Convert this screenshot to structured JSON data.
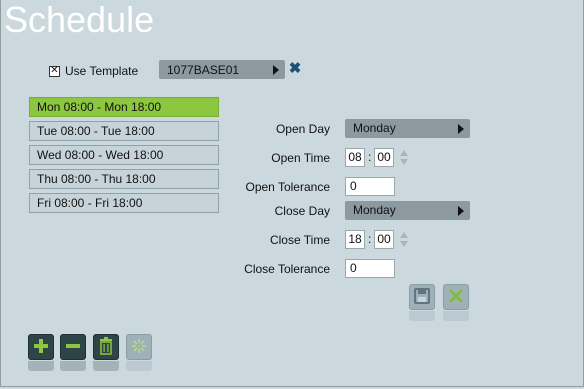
{
  "title": "Schedule",
  "template": {
    "checked": true,
    "check_mark": "✕",
    "label": "Use Template",
    "selected": "1077BASE01",
    "clear_symbol": "✖"
  },
  "slots": [
    {
      "label": "Mon 08:00 - Mon 18:00",
      "active": true
    },
    {
      "label": "Tue 08:00 - Tue 18:00",
      "active": false
    },
    {
      "label": "Wed 08:00 - Wed 18:00",
      "active": false
    },
    {
      "label": "Thu 08:00 - Thu 18:00",
      "active": false
    },
    {
      "label": "Fri 08:00 - Fri 18:00",
      "active": false
    }
  ],
  "form": {
    "open_day_label": "Open Day",
    "open_day_value": "Monday",
    "open_time_label": "Open Time",
    "open_hour": "08",
    "open_minute": "00",
    "open_tolerance_label": "Open Tolerance",
    "open_tolerance_value": "0",
    "close_day_label": "Close Day",
    "close_day_value": "Monday",
    "close_time_label": "Close Time",
    "close_hour": "18",
    "close_minute": "00",
    "close_tolerance_label": "Close Tolerance",
    "close_tolerance_value": "0",
    "time_separator": ":"
  },
  "icons": {
    "save": "save-icon",
    "cancel": "cancel-icon",
    "add": "add-icon",
    "remove": "remove-icon",
    "delete": "trash-icon",
    "clear_all": "sparkle-icon"
  },
  "colors": {
    "active_slot": "#8dc63f",
    "dropdown": "#8c9aa0",
    "dark_button": "#2f4446",
    "add_green": "#8dc63f"
  }
}
